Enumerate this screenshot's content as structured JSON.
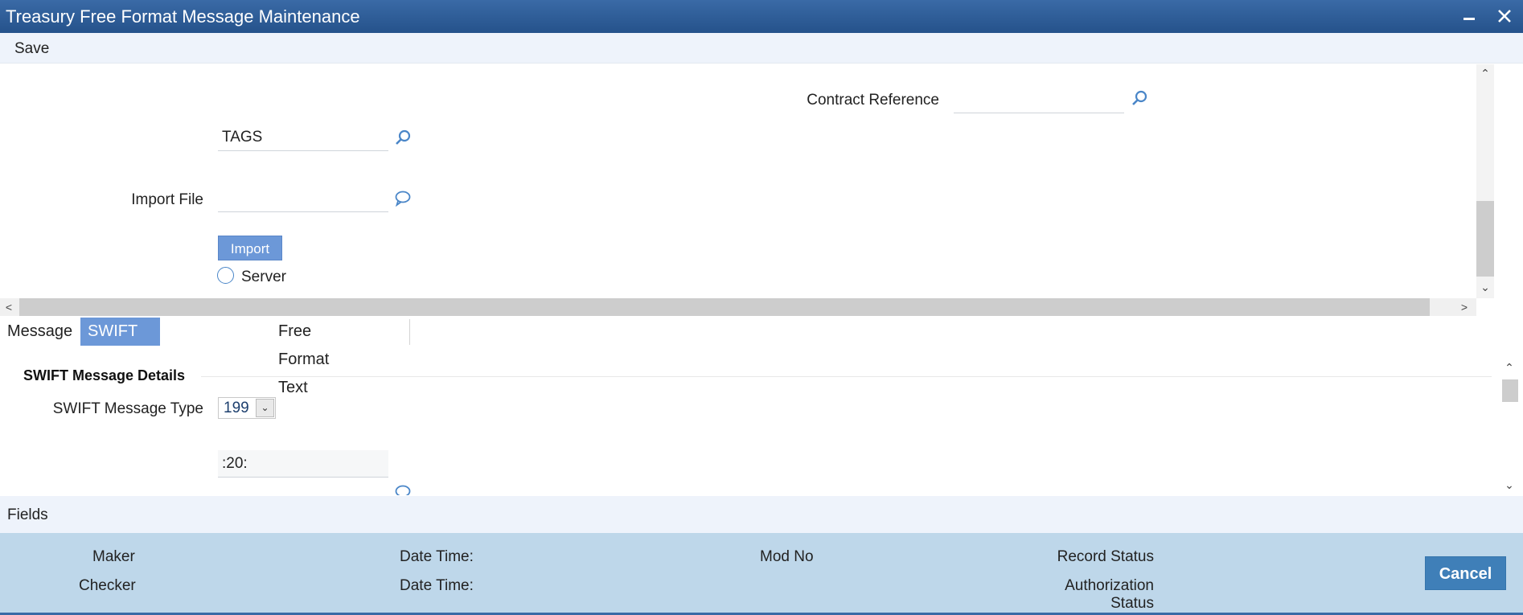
{
  "window": {
    "title": "Treasury Free Format Message Maintenance"
  },
  "toolbar": {
    "save_label": "Save"
  },
  "form": {
    "contract_reference": {
      "label": "Contract Reference",
      "value": ""
    },
    "tags": {
      "value": "TAGS"
    },
    "import_file": {
      "label": "Import File",
      "value": ""
    },
    "import_button": "Import",
    "server_radio": "Server"
  },
  "tabs": [
    {
      "label": "Message",
      "active": false
    },
    {
      "label": "SWIFT Message Details",
      "active": true
    },
    {
      "label": "Free Format Text",
      "active": false
    }
  ],
  "swift": {
    "section_title": "SWIFT Message Details",
    "message_type_label": "SWIFT Message Type",
    "message_type_value": "199",
    "field_20": ":20:"
  },
  "fields_bar": "Fields",
  "audit": {
    "maker": "Maker",
    "checker": "Checker",
    "date_time_1": "Date Time:",
    "date_time_2": "Date Time:",
    "mod_no": "Mod No",
    "record_status": "Record Status",
    "authorization_status": "Authorization Status",
    "cancel": "Cancel"
  },
  "colors": {
    "title_bar": "#2c5a92",
    "active_tab": "#6c98d8",
    "footer": "#bed7ea",
    "button": "#3f7fb8"
  },
  "icons": {
    "lookup": "magnifier-icon",
    "comment": "speech-bubble-icon"
  }
}
